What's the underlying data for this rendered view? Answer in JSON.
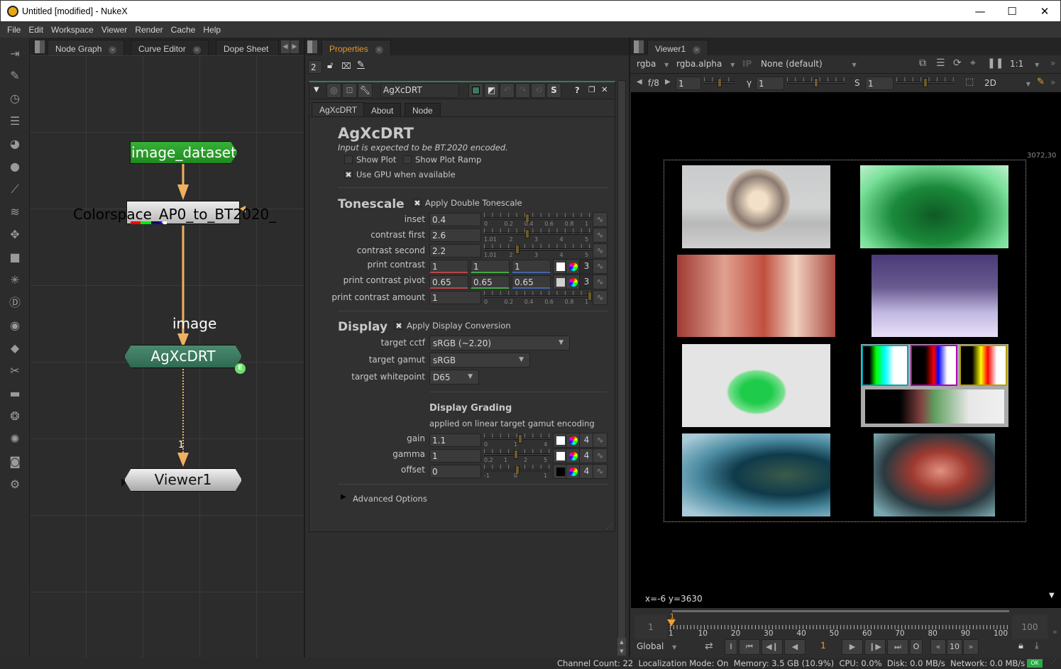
{
  "window": {
    "title": "Untitled [modified] - NukeX",
    "minimize_glyph": "—",
    "maximize_glyph": "☐",
    "close_glyph": "✕"
  },
  "menubar": {
    "items": [
      "File",
      "Edit",
      "Workspace",
      "Viewer",
      "Render",
      "Cache",
      "Help"
    ]
  },
  "toolbar": {
    "icons": [
      "image-icon",
      "draw-icon",
      "time-icon",
      "channel-icon",
      "color-icon",
      "filter-icon",
      "keyer-icon",
      "merge-icon",
      "transform-icon",
      "3d-icon",
      "particles-icon",
      "deep-icon",
      "views-icon",
      "metadata-icon",
      "toolsets-icon",
      "other-icon",
      "furnace-icon",
      "ocula-icon",
      "cara-vr-icon",
      "settings-icon"
    ]
  },
  "node_graph": {
    "tabs": [
      {
        "label": "Node Graph",
        "active": true
      },
      {
        "label": "Curve Editor",
        "active": false
      },
      {
        "label": "Dope Sheet",
        "active": false
      }
    ],
    "nodes": {
      "read": "image_dataset",
      "colorspace": "Colorspace_AP0_to_BT2020_",
      "input_label": "image",
      "drt": "AgXcDRT",
      "drt_badge": "E",
      "viewer_input": "1",
      "viewer": "Viewer1"
    },
    "colors": {
      "read": "#2a9a2a",
      "drt": "#3a7a60",
      "pipe": "#f0b060"
    }
  },
  "properties": {
    "tab_label": "Properties",
    "max_panels": "2",
    "node_name": "AgXcDRT",
    "node_tabs": [
      "AgXcDRT",
      "About",
      "Node"
    ],
    "title": "AgXcDRT",
    "subtitle": "Input is expected to be BT.2020 encoded.",
    "show_plot": {
      "label": "Show Plot",
      "checked": false
    },
    "show_plot_ramp": {
      "label": "Show Plot Ramp",
      "checked": false
    },
    "use_gpu": {
      "label": "Use GPU when available",
      "checked": true
    },
    "tonescale": {
      "header": "Tonescale",
      "apply_double": {
        "label": "Apply Double Tonescale",
        "checked": true
      },
      "inset": {
        "label": "inset",
        "value": "0.4",
        "slider_ticks": [
          "0",
          "0.2",
          "0.4",
          "0.6",
          "0.8",
          "1"
        ],
        "slider_fraction": 0.4
      },
      "contrast_first": {
        "label": "contrast first",
        "value": "2.6",
        "slider_ticks": [
          "1.01",
          "2",
          "3",
          "4",
          "5"
        ],
        "slider_fraction": 0.4
      },
      "contrast_second": {
        "label": "contrast second",
        "value": "2.2",
        "slider_ticks": [
          "1.01",
          "2",
          "3",
          "4",
          "5"
        ],
        "slider_fraction": 0.3
      },
      "print_contrast": {
        "label": "print contrast",
        "r": "1",
        "g": "1",
        "b": "1",
        "channels": "3"
      },
      "print_contrast_pivot": {
        "label": "print contrast pivot",
        "r": "0.65",
        "g": "0.65",
        "b": "0.65",
        "channels": "3"
      },
      "print_contrast_amount": {
        "label": "print contrast amount",
        "value": "1",
        "slider_ticks": [
          "0",
          "0.2",
          "0.4",
          "0.6",
          "0.8",
          "1"
        ],
        "slider_fraction": 1.0
      }
    },
    "display": {
      "header": "Display",
      "apply_conversion": {
        "label": "Apply Display Conversion",
        "checked": true
      },
      "target_cctf": {
        "label": "target cctf",
        "value": "sRGB (~2.20)"
      },
      "target_gamut": {
        "label": "target gamut",
        "value": "sRGB"
      },
      "target_whitepoint": {
        "label": "target whitepoint",
        "value": "D65"
      }
    },
    "display_grading": {
      "header": "Display Grading",
      "note": "applied on linear target gamut encoding",
      "gain": {
        "label": "gain",
        "value": "1.1",
        "slider_ticks": [
          "0",
          "1",
          "4"
        ],
        "slider_fraction": 0.55,
        "channels": "4"
      },
      "gamma": {
        "label": "gamma",
        "value": "1",
        "slider_ticks": [
          "0.2",
          "1",
          "2",
          "5"
        ],
        "slider_fraction": 0.48,
        "channels": "4"
      },
      "offset": {
        "label": "offset",
        "value": "0",
        "slider_ticks": [
          "-1",
          "0",
          "1"
        ],
        "slider_fraction": 0.5,
        "channels": "4"
      }
    },
    "advanced": "Advanced Options"
  },
  "viewer": {
    "tab_label": "Viewer1",
    "channels": "rgba",
    "alpha_channel": "rgba.alpha",
    "ip_label": "IP",
    "lut": "None (default)",
    "zoom": "1:1",
    "fstop_label": "f/8",
    "gain_value": "1",
    "gain_ticks": [
      "0.01",
      "0.5625",
      "1"
    ],
    "gamma_label": "γ",
    "gamma_value": "1",
    "gamma_ticks": [
      "0",
      "1",
      "4"
    ],
    "sat_label": "S",
    "sat_value": "1",
    "sat_ticks": [
      "0",
      "1",
      "4"
    ],
    "mode": "2D",
    "format_corner": "3072,30",
    "coords": "x=-6 y=3630",
    "timeline": {
      "in": "1",
      "out": "100",
      "current_marker": "1",
      "ticks": [
        "1",
        "10",
        "20",
        "30",
        "40",
        "50",
        "60",
        "70",
        "80",
        "90",
        "100"
      ]
    },
    "playback": {
      "range": "Global",
      "in_btn": "I",
      "out_btn": "O",
      "frame": "1",
      "step": "10"
    }
  },
  "statusbar": {
    "text": "Channel Count: 22  Localization Mode: On  Memory: 3.5 GB (10.9%)  CPU: 0.0%  Disk: 0.0 MB/s  Network: 0.0 MB/s",
    "ok": "OK"
  }
}
